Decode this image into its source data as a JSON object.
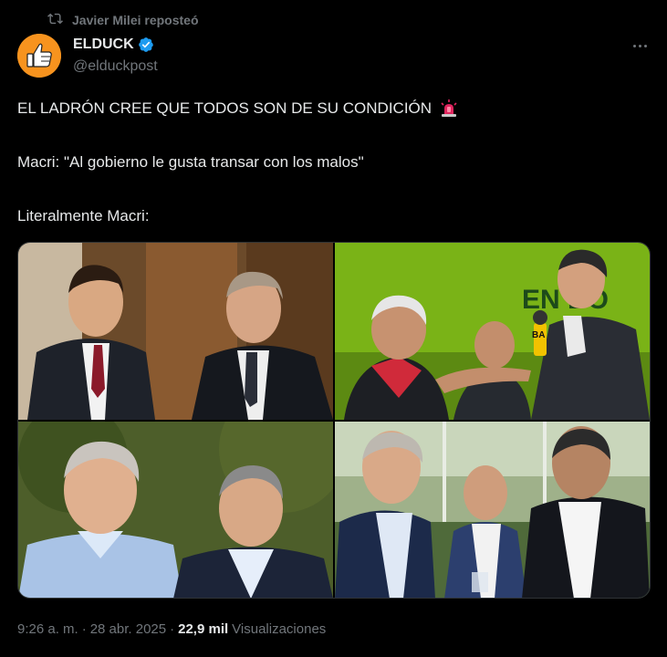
{
  "repost": {
    "text": "Javier Milei reposteó"
  },
  "author": {
    "name": "ELDUCK",
    "handle": "@elduckpost",
    "verified": true,
    "avatar_icon": "thumbs-up-icon"
  },
  "tweet": {
    "line1": "EL LADRÓN CREE QUE TODOS SON DE SU CONDICIÓN",
    "line1_emoji": "siren-icon",
    "line2": "Macri: \"Al gobierno le gusta transar con los malos\"",
    "line3": "Literalmente Macri:"
  },
  "media": {
    "photos": [
      {
        "icon": "photo-two-men-suits-icon"
      },
      {
        "icon": "photo-men-green-background-icon"
      },
      {
        "icon": "photo-two-men-outdoors-icon"
      },
      {
        "icon": "photo-three-men-window-icon"
      }
    ],
    "banner_text": "EN DO",
    "mic_text": "BA"
  },
  "footer": {
    "time": "9:26 a. m.",
    "separator": "·",
    "date": "28 abr. 2025",
    "separator2": "·",
    "views": "22,9 mil",
    "views_label": "Visualizaciones"
  },
  "colors": {
    "background": "#000000",
    "text": "#e7e9ea",
    "muted": "#71767b",
    "verified": "#1d9bf0",
    "avatar": "#f7931e"
  }
}
